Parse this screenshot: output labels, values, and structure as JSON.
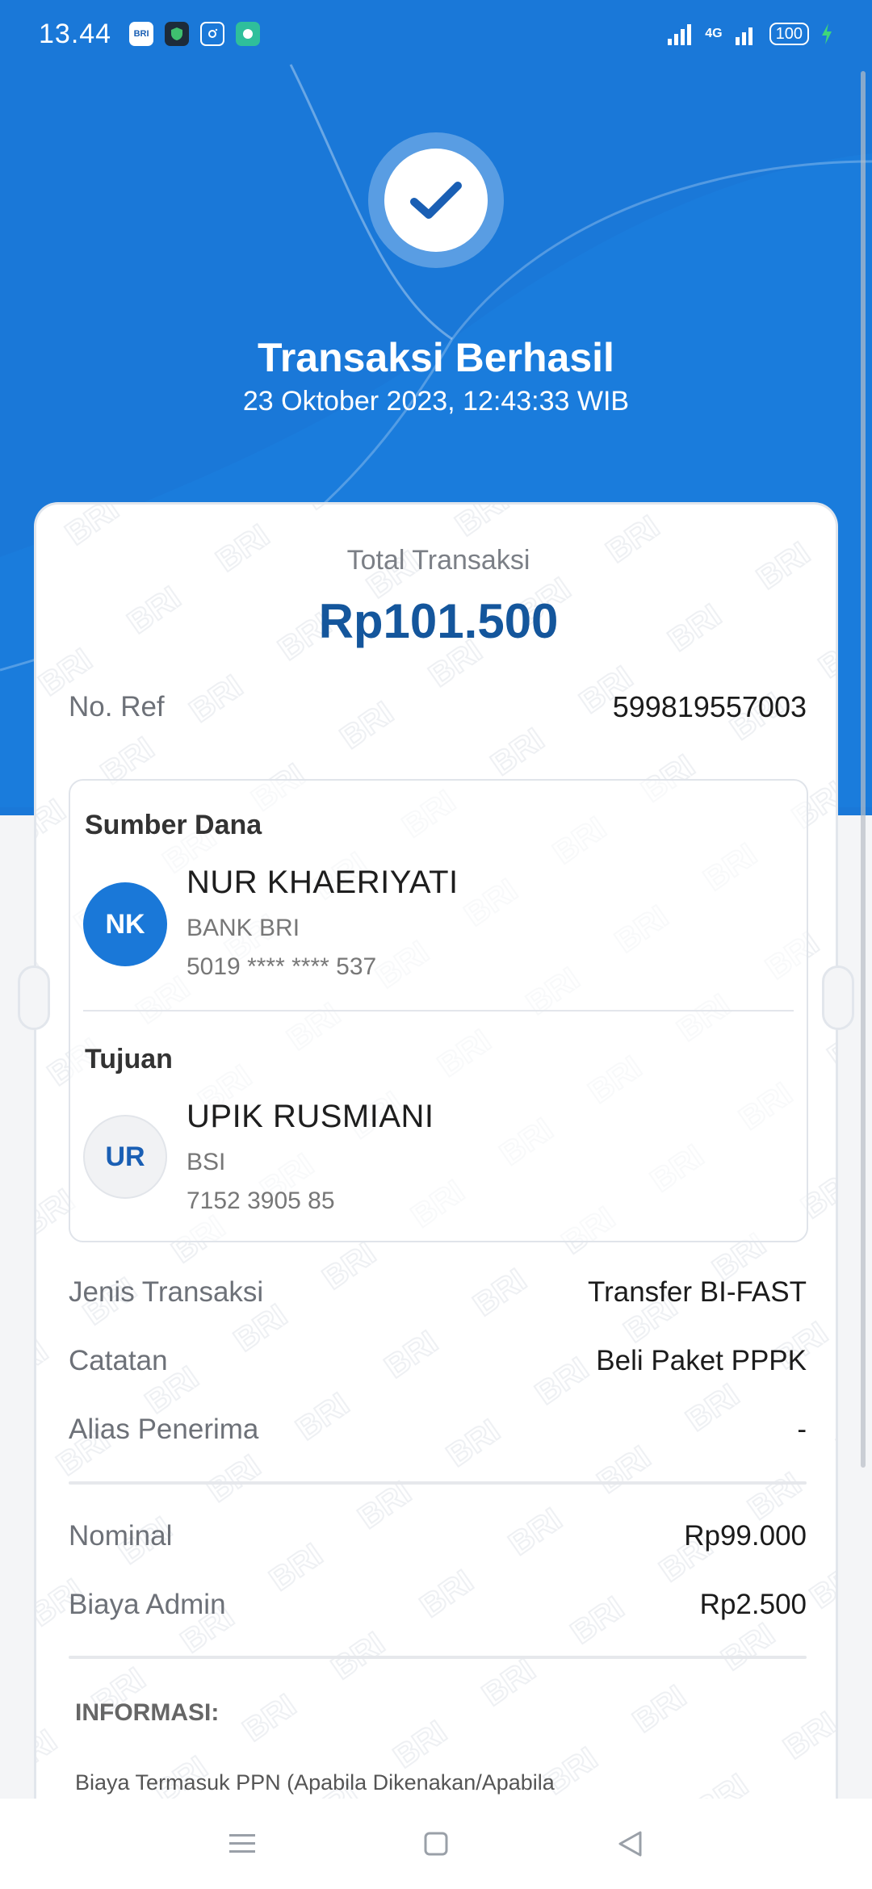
{
  "status_bar": {
    "time": "13.44",
    "apps": [
      {
        "name": "brimo-icon",
        "label": "BRI mo",
        "color": "#1a5fb4"
      },
      {
        "name": "shield-app-icon",
        "label": "",
        "color": "#1d2b3a"
      },
      {
        "name": "instagram-icon",
        "label": "",
        "color": "#1a78d8"
      },
      {
        "name": "chat-app-icon",
        "label": "",
        "color": "#2fbf9b"
      }
    ],
    "network": "4G",
    "battery": "100"
  },
  "header": {
    "status_icon": "check-icon",
    "title": "Transaksi Berhasil",
    "datetime": "23 Oktober 2023, 12:43:33 WIB"
  },
  "receipt": {
    "total_label": "Total Transaksi",
    "total_amount": "Rp101.500",
    "ref_label": "No. Ref",
    "ref_value": "599819557003",
    "source": {
      "section_title": "Sumber Dana",
      "initials": "NK",
      "name": "NUR KHAERIYATI",
      "bank": "BANK BRI",
      "account": "5019 **** **** 537"
    },
    "destination": {
      "section_title": "Tujuan",
      "initials": "UR",
      "name": "UPIK RUSMIANI",
      "bank": "BSI",
      "account": "7152 3905 85"
    },
    "details": [
      {
        "label": "Jenis Transaksi",
        "value": "Transfer BI-FAST"
      },
      {
        "label": "Catatan",
        "value": "Beli Paket PPPK"
      },
      {
        "label": "Alias Penerima",
        "value": "-"
      }
    ],
    "costs": [
      {
        "label": "Nominal",
        "value": "Rp99.000"
      },
      {
        "label": "Biaya Admin",
        "value": "Rp2.500"
      }
    ],
    "info_title": "INFORMASI:",
    "info_text": "Biaya Termasuk PPN (Apabila Dikenakan/Apabila",
    "watermark_text": "BRI"
  },
  "navbar": {
    "menu": "menu-icon",
    "home": "home-icon",
    "back": "back-icon"
  },
  "colors": {
    "brand_blue": "#1a78d8",
    "amount_blue": "#14569c",
    "avatar_nk_bg": "#1a78d8",
    "avatar_ur_bg": "#f1f2f4"
  }
}
